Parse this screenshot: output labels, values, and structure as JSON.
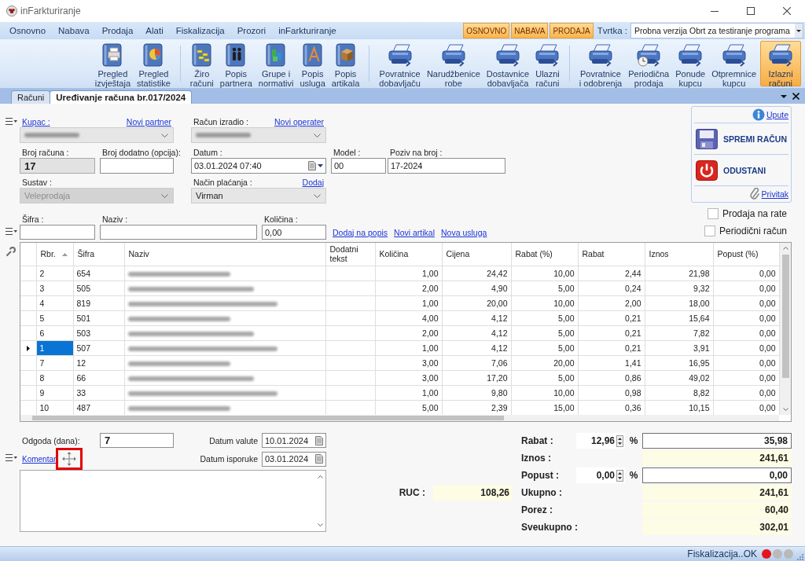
{
  "window": {
    "title": "inFarkturiranje"
  },
  "menu": {
    "items": [
      "Osnovno",
      "Nabava",
      "Prodaja",
      "Alati",
      "Fiskalizacija",
      "Prozori",
      "inFarkturiranje"
    ],
    "modules": [
      "OSNOVNO",
      "NABAVA",
      "PRODAJA"
    ],
    "company": {
      "label": "Tvrtka :",
      "value": "Probna verzija Obrt za testiranje programa"
    }
  },
  "ribbon": {
    "groups": [
      [
        {
          "kind": "report",
          "lines": [
            "Pregled",
            "izvještaja"
          ],
          "selected": false
        },
        {
          "kind": "statistics",
          "lines": [
            "Pregled",
            "statistike"
          ],
          "selected": false
        }
      ],
      [
        {
          "kind": "accounts",
          "lines": [
            "Žiro",
            "računi"
          ],
          "selected": false
        },
        {
          "kind": "partners",
          "lines": [
            "Popis",
            "partnera"
          ],
          "selected": false
        },
        {
          "kind": "groups",
          "lines": [
            "Grupe i",
            "normativi"
          ],
          "selected": false
        },
        {
          "kind": "services",
          "lines": [
            "Popis",
            "usluga"
          ],
          "selected": false
        },
        {
          "kind": "articles",
          "lines": [
            "Popis",
            "artikala"
          ],
          "selected": false
        }
      ],
      [
        {
          "kind": "document",
          "lines": [
            "Povratnice",
            "dobavljaču"
          ],
          "selected": false
        },
        {
          "kind": "document",
          "lines": [
            "Narudžbenice",
            "robe"
          ],
          "selected": false
        },
        {
          "kind": "document",
          "lines": [
            "Dostavnice",
            "dobavljača"
          ],
          "selected": false
        },
        {
          "kind": "document",
          "lines": [
            "Ulazni",
            "računi"
          ],
          "selected": false
        }
      ],
      [
        {
          "kind": "document",
          "lines": [
            "Povratnice",
            "i odobrenja"
          ],
          "selected": false
        },
        {
          "kind": "periodic",
          "lines": [
            "Periodična",
            "prodaja"
          ],
          "selected": false
        },
        {
          "kind": "document",
          "lines": [
            "Ponude",
            "kupcu"
          ],
          "selected": false
        },
        {
          "kind": "document",
          "lines": [
            "Otpremnice",
            "kupcu"
          ],
          "selected": false
        },
        {
          "kind": "document",
          "lines": [
            "Izlazni",
            "računi"
          ],
          "selected": true
        }
      ]
    ]
  },
  "tabs": [
    {
      "label": "Računi",
      "selected": false
    },
    {
      "label": "Uređivanje računa br.017/2024",
      "selected": true
    }
  ],
  "invoice_form": {
    "customer": {
      "label": "Kupac :",
      "link": "Novi partner",
      "redacted": true,
      "disabled": false
    },
    "issued_by": {
      "label": "Račun izradio :",
      "link": "Novi operater",
      "redacted": true,
      "disabled": false
    },
    "invoice_number": {
      "label": "Broj računa :",
      "value": "17",
      "readonly": true
    },
    "extra_number": {
      "label": "Broj dodatno (opcija):"
    },
    "date": {
      "label": "Datum :",
      "value": "03.01.2024 07:40"
    },
    "model": {
      "label": "Model :",
      "value": "00"
    },
    "reference": {
      "label": "Poziv na broj :",
      "value": "17-2024"
    },
    "system": {
      "label": "Sustav :",
      "value": "Veleprodaja",
      "disabled": true
    },
    "payment": {
      "label": "Način plaćanja :",
      "link": "Dodaj",
      "value": "Virman",
      "disabled": false
    }
  },
  "actions": {
    "help": "Upute",
    "save": "SPREMI RAČUN",
    "cancel": "ODUSTANI",
    "attachment": "Privitak"
  },
  "options": [
    {
      "label": "Prodaja na rate",
      "checked": false
    },
    {
      "label": "Periodični račun",
      "checked": false
    }
  ],
  "item_entry": {
    "code": {
      "label": "Šifra :"
    },
    "name": {
      "label": "Naziv :"
    },
    "quantity": {
      "label": "Količina :",
      "value": "0,00"
    },
    "links": [
      "Dodaj na popis",
      "Novi artikal",
      "Nova usluga"
    ]
  },
  "table": {
    "columns": [
      {
        "label": "Rbr.",
        "sorted": true
      },
      {
        "label": "Šifra",
        "sorted": false
      },
      {
        "label": "Naziv",
        "sorted": false
      },
      {
        "label": "Dodatni tekst",
        "sorted": false
      },
      {
        "label": "Količina",
        "sorted": false
      },
      {
        "label": "Cijena",
        "sorted": false
      },
      {
        "label": "Rabat (%)",
        "sorted": false
      },
      {
        "label": "Rabat",
        "sorted": false
      },
      {
        "label": "Iznos",
        "sorted": false
      },
      {
        "label": "Popust (%)",
        "sorted": false
      }
    ],
    "rows": [
      {
        "rbr": "2",
        "sifra": "654",
        "name_redacted": true,
        "values": [
          "1,00",
          "24,42",
          "10,00",
          "2,44",
          "21,98",
          "0,00"
        ],
        "selected": false
      },
      {
        "rbr": "3",
        "sifra": "505",
        "name_redacted": true,
        "values": [
          "2,00",
          "4,90",
          "5,00",
          "0,24",
          "9,32",
          "0,00"
        ],
        "selected": false
      },
      {
        "rbr": "4",
        "sifra": "819",
        "name_redacted": true,
        "values": [
          "1,00",
          "20,00",
          "10,00",
          "2,00",
          "18,00",
          "0,00"
        ],
        "selected": false
      },
      {
        "rbr": "5",
        "sifra": "501",
        "name_redacted": true,
        "values": [
          "4,00",
          "4,12",
          "5,00",
          "0,21",
          "15,64",
          "0,00"
        ],
        "selected": false
      },
      {
        "rbr": "6",
        "sifra": "503",
        "name_redacted": true,
        "values": [
          "2,00",
          "4,12",
          "5,00",
          "0,21",
          "7,82",
          "0,00"
        ],
        "selected": false
      },
      {
        "rbr": "1",
        "sifra": "507",
        "name_redacted": true,
        "values": [
          "1,00",
          "4,12",
          "5,00",
          "0,21",
          "3,91",
          "0,00"
        ],
        "selected": true
      },
      {
        "rbr": "7",
        "sifra": "12",
        "name_redacted": true,
        "values": [
          "3,00",
          "7,06",
          "20,00",
          "1,41",
          "16,95",
          "0,00"
        ],
        "selected": false
      },
      {
        "rbr": "8",
        "sifra": "66",
        "name_redacted": true,
        "values": [
          "3,00",
          "17,20",
          "5,00",
          "0,86",
          "49,02",
          "0,00"
        ],
        "selected": false
      },
      {
        "rbr": "9",
        "sifra": "33",
        "name_redacted": true,
        "values": [
          "1,00",
          "9,80",
          "10,00",
          "0,98",
          "8,82",
          "0,00"
        ],
        "selected": false
      },
      {
        "rbr": "10",
        "sifra": "487",
        "name_redacted": true,
        "values": [
          "5,00",
          "2,39",
          "15,00",
          "0,36",
          "10,15",
          "0,00"
        ],
        "selected": false
      }
    ]
  },
  "terms": {
    "delay_label": "Odgoda (dana):",
    "delay_value": "7",
    "value_date_label": "Datum valute",
    "value_date": "10.01.2024",
    "delivery_date_label": "Datum isporuke",
    "delivery_date": "03.01.2024"
  },
  "comment": {
    "label": "Komentar",
    "handle_highlighted": true
  },
  "ruc": {
    "label": "RUC :",
    "value": "108,26"
  },
  "totals": [
    {
      "label": "Rabat :",
      "kind": "percent",
      "percent": "12,96",
      "unit": "%",
      "value": "35,98"
    },
    {
      "label": "Iznos :",
      "kind": "readonly",
      "value": "241,61"
    },
    {
      "label": "Popust :",
      "kind": "percent",
      "percent": "0,00",
      "unit": "%",
      "value": "0,00"
    },
    {
      "label": "Ukupno :",
      "kind": "readonly",
      "value": "241,61"
    },
    {
      "label": "Porez :",
      "kind": "readonly",
      "value": "60,40"
    },
    {
      "label": "Sveukupno :",
      "kind": "readonly",
      "value": "302,01"
    }
  ],
  "status_bar": {
    "text": "Fiskalizacija..OK",
    "lights": [
      {
        "color": "#e5151d"
      },
      {
        "color": "#b9b9b9"
      },
      {
        "color": "#b9b9b9"
      }
    ]
  }
}
